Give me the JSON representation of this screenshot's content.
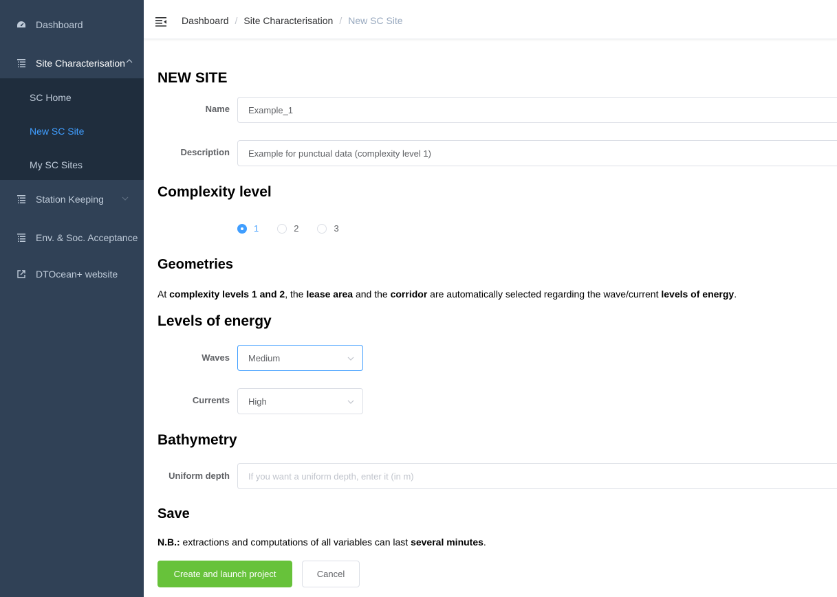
{
  "sidebar": {
    "items": [
      {
        "label": "Dashboard",
        "icon": "dashboard-icon"
      },
      {
        "label": "Site Characterisation",
        "icon": "list-icon"
      },
      {
        "label": "Station Keeping",
        "icon": "list-icon"
      },
      {
        "label": "Env. & Soc. Acceptance",
        "icon": "list-icon"
      },
      {
        "label": "DTOcean+ website",
        "icon": "external-link-icon"
      }
    ],
    "submenu": [
      {
        "label": "SC Home"
      },
      {
        "label": "New SC Site"
      },
      {
        "label": "My SC Sites"
      }
    ],
    "colors": {
      "background": "#304156",
      "submenu_background": "#1f2d3d",
      "text": "#bfcbd9",
      "active": "#409eff"
    }
  },
  "header": {
    "breadcrumb": [
      "Dashboard",
      "Site Characterisation",
      "New SC Site"
    ],
    "separator": "/"
  },
  "form": {
    "title": "NEW SITE",
    "name_label": "Name",
    "name_value": "Example_1",
    "description_label": "Description",
    "description_value": "Example for punctual data (complexity level 1)",
    "complexity_heading": "Complexity level",
    "complexity_options": [
      "1",
      "2",
      "3"
    ],
    "complexity_selected": "1",
    "geometries_heading": "Geometries",
    "geometries_text": {
      "p1": "At ",
      "b1": "complexity levels 1 and 2",
      "p2": ", the ",
      "b2": "lease area",
      "p3": " and the ",
      "b3": "corridor",
      "p4": " are automatically selected regarding the wave/current ",
      "b4": "levels of energy",
      "p5": "."
    },
    "energy_heading": "Levels of energy",
    "waves_label": "Waves",
    "waves_value": "Medium",
    "currents_label": "Currents",
    "currents_value": "High",
    "bathymetry_heading": "Bathymetry",
    "depth_label": "Uniform depth",
    "depth_placeholder": "If you want a uniform depth, enter it (in m)",
    "save_heading": "Save",
    "note": {
      "b1": "N.B.:",
      "p1": " extractions and computations of all variables can last ",
      "b2": "several minutes",
      "p2": "."
    },
    "create_button": "Create and launch project",
    "cancel_button": "Cancel"
  },
  "colors": {
    "primary": "#409eff",
    "success": "#67c23a",
    "border": "#dcdfe6"
  }
}
